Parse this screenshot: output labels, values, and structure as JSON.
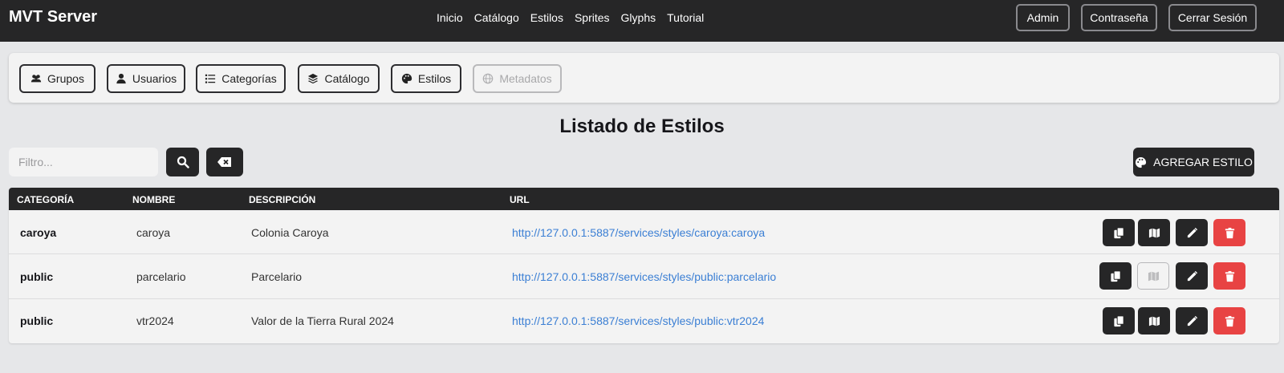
{
  "app": {
    "brand": "MVT Server"
  },
  "topnav": {
    "links": [
      "Inicio",
      "Catálogo",
      "Estilos",
      "Sprites",
      "Glyphs",
      "Tutorial"
    ],
    "admin_label": "Admin",
    "password_label": "Contraseña",
    "logout_label": "Cerrar Sesión"
  },
  "panel": {
    "buttons": [
      {
        "label": "Grupos",
        "icon": "users-icon"
      },
      {
        "label": "Usuarios",
        "icon": "user-icon"
      },
      {
        "label": "Categorías",
        "icon": "list-icon"
      },
      {
        "label": "Catálogo",
        "icon": "layers-icon"
      },
      {
        "label": "Estilos",
        "icon": "palette-icon"
      },
      {
        "label": "Metadatos",
        "icon": "globe-icon",
        "disabled": true
      }
    ]
  },
  "page": {
    "title": "Listado de Estilos"
  },
  "filter": {
    "placeholder": "Filtro..."
  },
  "add_button": {
    "label": "AGREGAR ESTILO"
  },
  "table": {
    "headers": [
      "CATEGORÍA",
      "NOMBRE",
      "DESCRIPCIÓN",
      "URL"
    ],
    "rows": [
      {
        "category": "caroya",
        "name": "caroya",
        "description": "Colonia Caroya",
        "url": "http://127.0.0.1:5887/services/styles/caroya:caroya",
        "map_enabled": true
      },
      {
        "category": "public",
        "name": "parcelario",
        "description": "Parcelario",
        "url": "http://127.0.0.1:5887/services/styles/public:parcelario",
        "map_enabled": false
      },
      {
        "category": "public",
        "name": "vtr2024",
        "description": "Valor de la Tierra Rural 2024",
        "url": "http://127.0.0.1:5887/services/styles/public:vtr2024",
        "map_enabled": true
      }
    ]
  },
  "colors": {
    "dark": "#262627",
    "danger": "#e84343",
    "link": "#3b7fd4"
  }
}
